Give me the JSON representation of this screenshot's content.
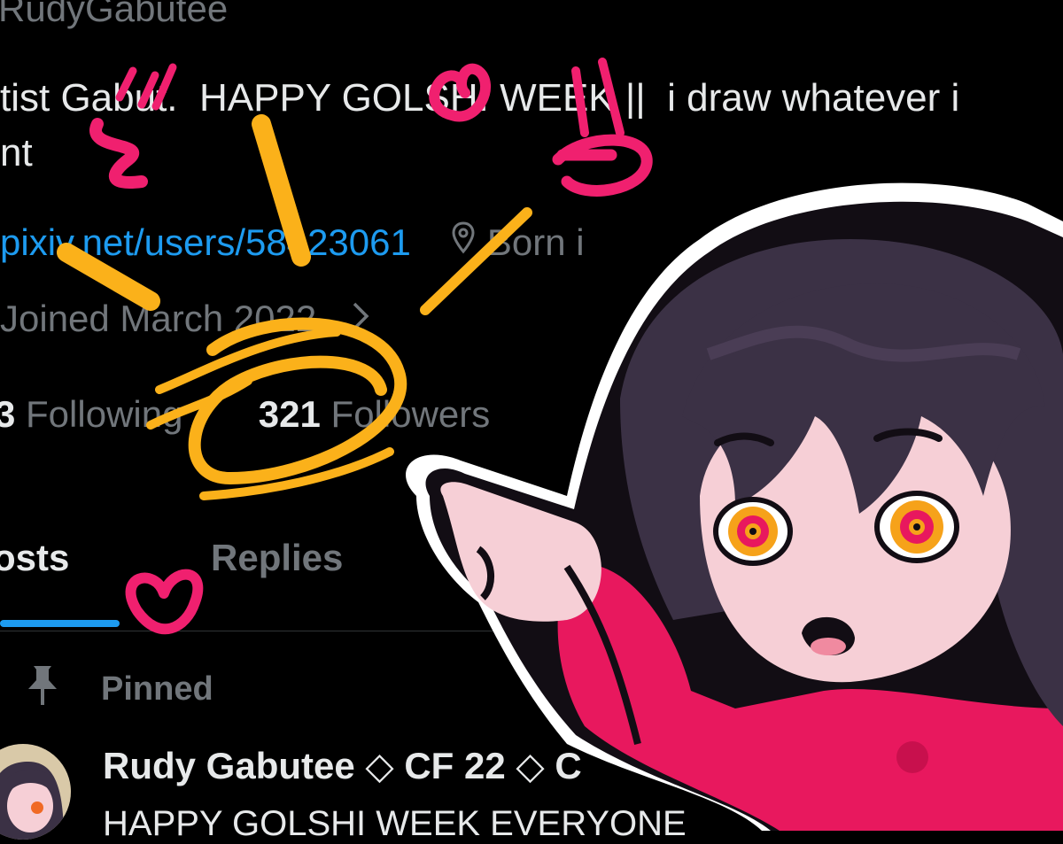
{
  "profile": {
    "handle": "RudyGabutee",
    "bio": "tist Gabut.  HAPPY GOLSHI WEEK ||  i draw whatever i\nnt",
    "website": "pixiv.net/users/58423061",
    "location_icon": "location-pin-icon",
    "location": "Born i",
    "joined": "Joined March 2022",
    "following_count": "3",
    "following_label": "Following",
    "followers_count": "321",
    "followers_label": "Followers"
  },
  "tabs": [
    {
      "label": "osts",
      "active": true
    },
    {
      "label": "Replies",
      "active": false
    }
  ],
  "pinned_label": "Pinned",
  "post": {
    "author": "Rudy Gabutee ◇ CF 22 ◇ C",
    "text": "HAPPY GOLSHI WEEK EVERYONE"
  },
  "colors": {
    "background": "#000000",
    "link": "#1d9bf0",
    "muted": "#71767b",
    "doodle_yellow": "#fbb11a",
    "doodle_pink": "#f0206f",
    "character_hair": "#3b3145",
    "character_skin": "#f6cfd6",
    "character_shirt": "#e8185e"
  }
}
